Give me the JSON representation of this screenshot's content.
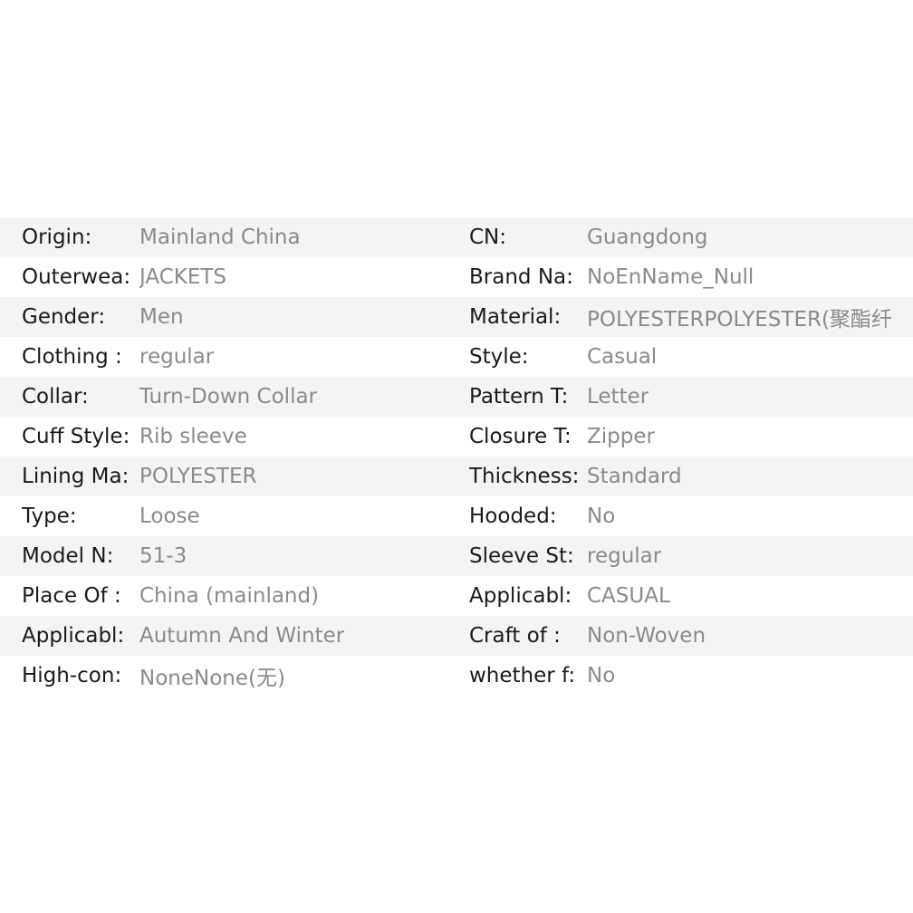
{
  "rows": [
    {
      "left": {
        "label": "Origin:",
        "value": "Mainland China"
      },
      "right": {
        "label": "CN:",
        "value": "Guangdong"
      }
    },
    {
      "left": {
        "label": "Outerwea:",
        "value": "JACKETS"
      },
      "right": {
        "label": "Brand Na:",
        "value": "NoEnName_Null"
      }
    },
    {
      "left": {
        "label": "Gender:",
        "value": "Men"
      },
      "right": {
        "label": "Material:",
        "value": "POLYESTERPOLYESTER(聚酯纤"
      }
    },
    {
      "left": {
        "label": "Clothing :",
        "value": "regular"
      },
      "right": {
        "label": "Style:",
        "value": "Casual"
      }
    },
    {
      "left": {
        "label": "Collar:",
        "value": "Turn-Down Collar"
      },
      "right": {
        "label": "Pattern T:",
        "value": "Letter"
      }
    },
    {
      "left": {
        "label": "Cuff Style:",
        "value": "Rib sleeve"
      },
      "right": {
        "label": "Closure T:",
        "value": "Zipper"
      }
    },
    {
      "left": {
        "label": "Lining Ma:",
        "value": "POLYESTER"
      },
      "right": {
        "label": "Thickness:",
        "value": "Standard"
      }
    },
    {
      "left": {
        "label": "Type:",
        "value": "Loose"
      },
      "right": {
        "label": "Hooded:",
        "value": "No"
      }
    },
    {
      "left": {
        "label": "Model N:",
        "value": "51-3"
      },
      "right": {
        "label": "Sleeve St:",
        "value": "regular"
      }
    },
    {
      "left": {
        "label": "Place Of :",
        "value": "China (mainland)"
      },
      "right": {
        "label": "Applicabl:",
        "value": "CASUAL"
      }
    },
    {
      "left": {
        "label": "Applicabl:",
        "value": "Autumn And Winter"
      },
      "right": {
        "label": "Craft of :",
        "value": "Non-Woven"
      }
    },
    {
      "left": {
        "label": "High-con:",
        "value": "NoneNone(无)"
      },
      "right": {
        "label": "whether f:",
        "value": "No"
      }
    }
  ]
}
